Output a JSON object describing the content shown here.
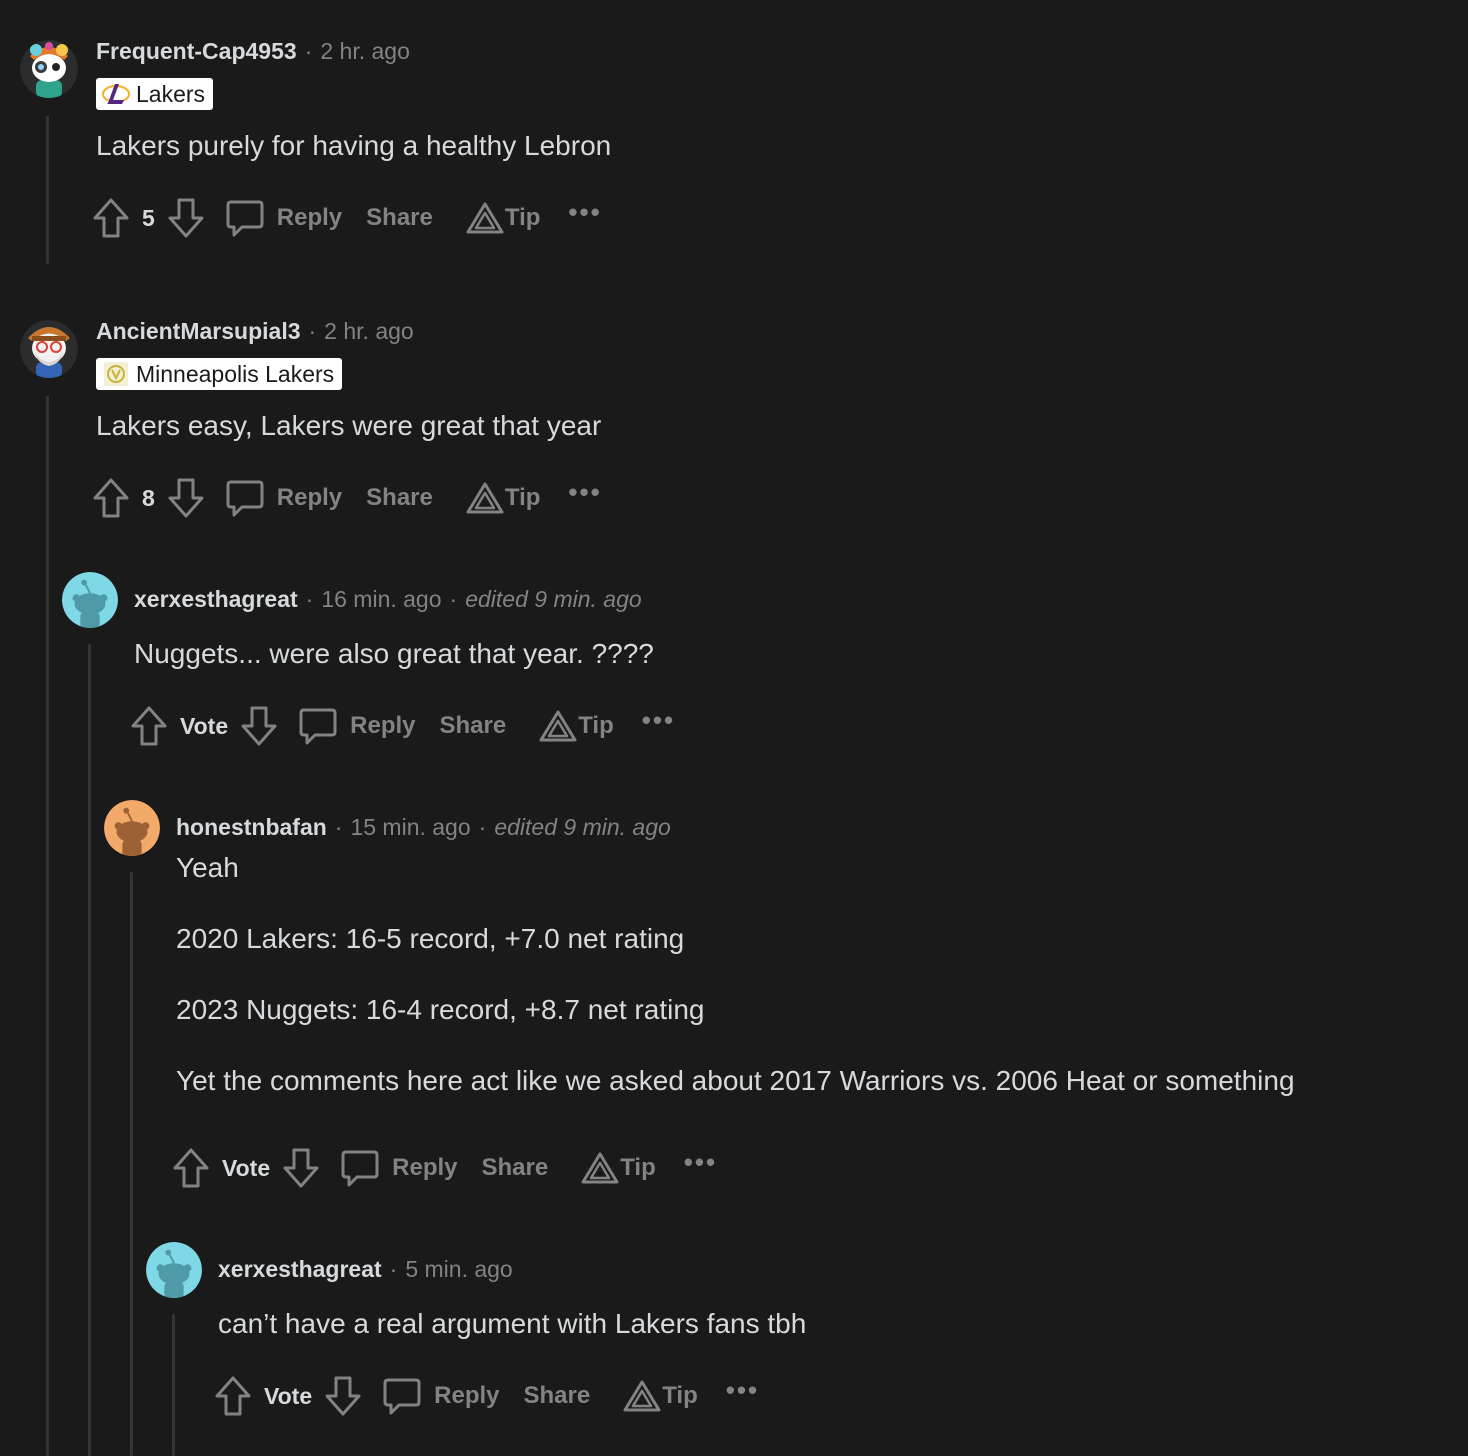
{
  "comments": [
    {
      "author": "Frequent-Cap4953",
      "time": "2 hr. ago",
      "edited": "",
      "flair": "Lakers",
      "body": [
        "Lakers purely for having a healthy Lebron"
      ],
      "score": "5",
      "avatar": "snoo-avatar-goggles"
    },
    {
      "author": "AncientMarsupial3",
      "time": "2 hr. ago",
      "edited": "",
      "flair": "Minneapolis Lakers",
      "body": [
        "Lakers easy, Lakers were great that year"
      ],
      "score": "8",
      "avatar": "snoo-avatar-bearded"
    },
    {
      "author": "xerxesthagreat",
      "time": "16 min. ago",
      "edited": "edited 9 min. ago",
      "flair": "",
      "body": [
        "Nuggets... were also great that year. ????"
      ],
      "score": "Vote",
      "avatar": "default-snoo-cyan"
    },
    {
      "author": "honestnbafan",
      "time": "15 min. ago",
      "edited": "edited 9 min. ago",
      "flair": "",
      "body": [
        "Yeah",
        "2020 Lakers: 16-5 record, +7.0 net rating",
        "2023 Nuggets: 16-4 record, +8.7 net rating",
        "Yet the comments here act like we asked about 2017 Warriors vs. 2006 Heat or something"
      ],
      "score": "Vote",
      "avatar": "default-snoo-orange"
    },
    {
      "author": "xerxesthagreat",
      "time": "5 min. ago",
      "edited": "",
      "flair": "",
      "body": [
        "can’t have a real argument with Lakers fans tbh"
      ],
      "score": "Vote",
      "avatar": "default-snoo-cyan"
    }
  ],
  "actions": {
    "reply": "Reply",
    "share": "Share",
    "tip": "Tip",
    "more": "•••"
  },
  "colors": {
    "background": "#1a1a1b",
    "text": "#d7dadc",
    "muted": "#818384",
    "thread_line": "#343536",
    "snoo_cyan": "#7ed8e6",
    "snoo_orange": "#f2a96a"
  }
}
